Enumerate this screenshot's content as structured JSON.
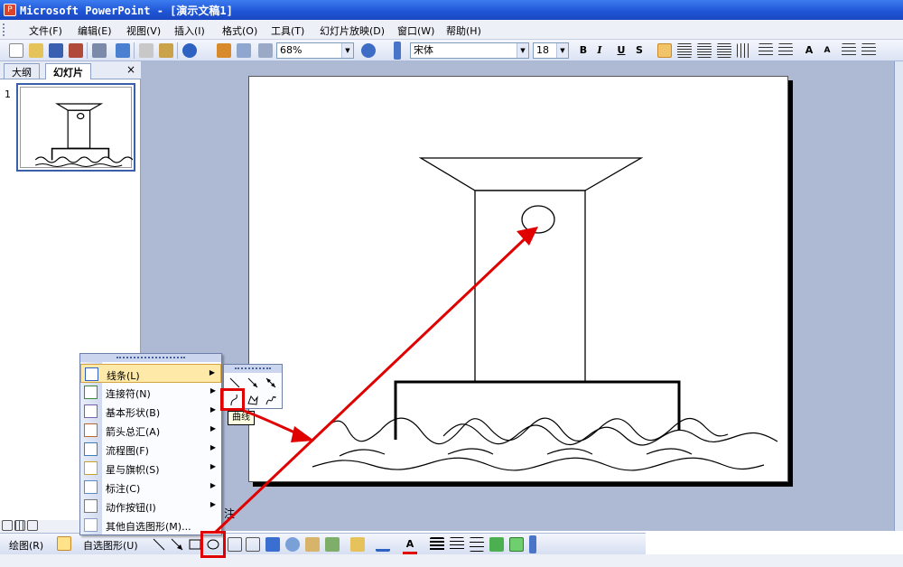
{
  "window": {
    "title": "Microsoft PowerPoint - [演示文稿1]"
  },
  "menubar": {
    "items": [
      "文件(F)",
      "编辑(E)",
      "视图(V)",
      "插入(I)",
      "格式(O)",
      "工具(T)",
      "幻灯片放映(D)",
      "窗口(W)",
      "帮助(H)"
    ]
  },
  "toolbar": {
    "zoom": "68%",
    "font_name": "宋体",
    "font_size": "18",
    "bold": "B",
    "italic": "I",
    "underline": "U",
    "shadow": "S"
  },
  "left_pane": {
    "tabs": [
      "大纲",
      "幻灯片"
    ],
    "close": "×",
    "slide_number": "1"
  },
  "autoshape_menu": {
    "items": [
      {
        "label": "线条(L)",
        "icon": "lines-icon",
        "submenu": true
      },
      {
        "label": "连接符(N)",
        "icon": "connector-icon",
        "submenu": true
      },
      {
        "label": "基本形状(B)",
        "icon": "basic-shapes-icon",
        "submenu": true
      },
      {
        "label": "箭头总汇(A)",
        "icon": "block-arrows-icon",
        "submenu": true
      },
      {
        "label": "流程图(F)",
        "icon": "flowchart-icon",
        "submenu": true
      },
      {
        "label": "星与旗帜(S)",
        "icon": "stars-banners-icon",
        "submenu": true
      },
      {
        "label": "标注(C)",
        "icon": "callouts-icon",
        "submenu": true
      },
      {
        "label": "动作按钮(I)",
        "icon": "action-buttons-icon",
        "submenu": true
      },
      {
        "label": "其他自选图形(M)...",
        "icon": "more-autoshapes-icon",
        "submenu": false
      }
    ],
    "submenu_arrow": "▶"
  },
  "lines_submenu": {
    "tooltip": "曲线"
  },
  "notes": {
    "text": "注"
  },
  "drawing_toolbar": {
    "draw": "绘图(R)",
    "autoshapes": "自选图形(U)"
  }
}
